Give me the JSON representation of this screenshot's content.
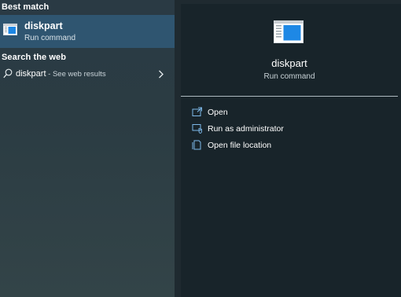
{
  "best_match": {
    "section_title": "Best match",
    "name": "diskpart",
    "subtitle": "Run command"
  },
  "web": {
    "section_title": "Search the web",
    "query": "diskpart",
    "suffix": " - See web results"
  },
  "detail": {
    "name": "diskpart",
    "subtitle": "Run command",
    "actions": [
      {
        "label": "Open",
        "icon": "open-icon"
      },
      {
        "label": "Run as administrator",
        "icon": "shield-admin-icon"
      },
      {
        "label": "Open file location",
        "icon": "file-location-icon"
      }
    ]
  },
  "colors": {
    "selected_bg": "#2f5570",
    "accent_icon": "#1e88e5",
    "right_bg": "#18242a"
  }
}
